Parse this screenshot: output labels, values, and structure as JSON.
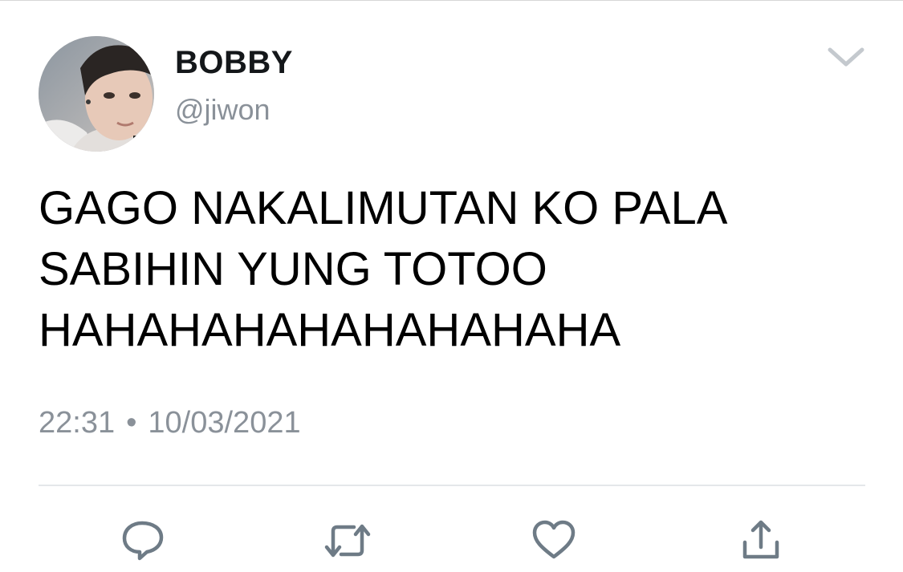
{
  "user": {
    "display_name": "BOBBY",
    "handle": "@jiwon"
  },
  "tweet": {
    "lines": [
      "GAGO NAKALIMUTAN KO PALA",
      "SABIHIN YUNG TOTOO",
      "HAHAHAHAHAHAHAHAHA"
    ]
  },
  "meta": {
    "time": "22:31",
    "separator": "•",
    "date": "10/03/2021"
  },
  "icons": {
    "menu": "chevron-down-icon",
    "reply": "reply-icon",
    "retweet": "retweet-icon",
    "like": "heart-icon",
    "share": "share-icon"
  },
  "colors": {
    "icon": "#6e7b86",
    "secondary_text": "#8a9199",
    "chevron": "#c4c9ce"
  }
}
